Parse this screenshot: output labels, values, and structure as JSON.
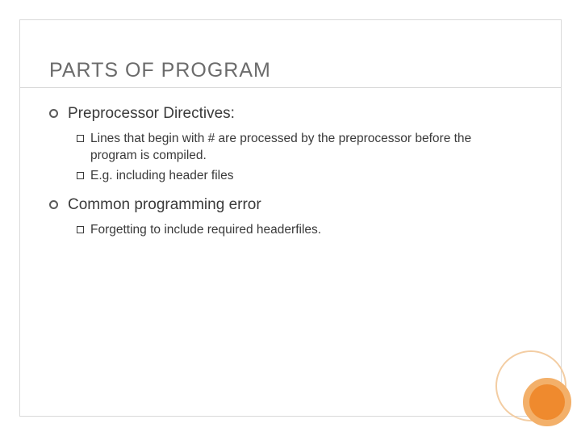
{
  "title": "PARTS OF PROGRAM",
  "items": [
    {
      "label": "Preprocessor Directives:",
      "subs": [
        "Lines that begin with # are processed by the preprocessor before the program is compiled.",
        "E.g. including header files"
      ]
    },
    {
      "label": "Common programming error",
      "subs": [
        "Forgetting to include required headerfiles."
      ]
    }
  ]
}
